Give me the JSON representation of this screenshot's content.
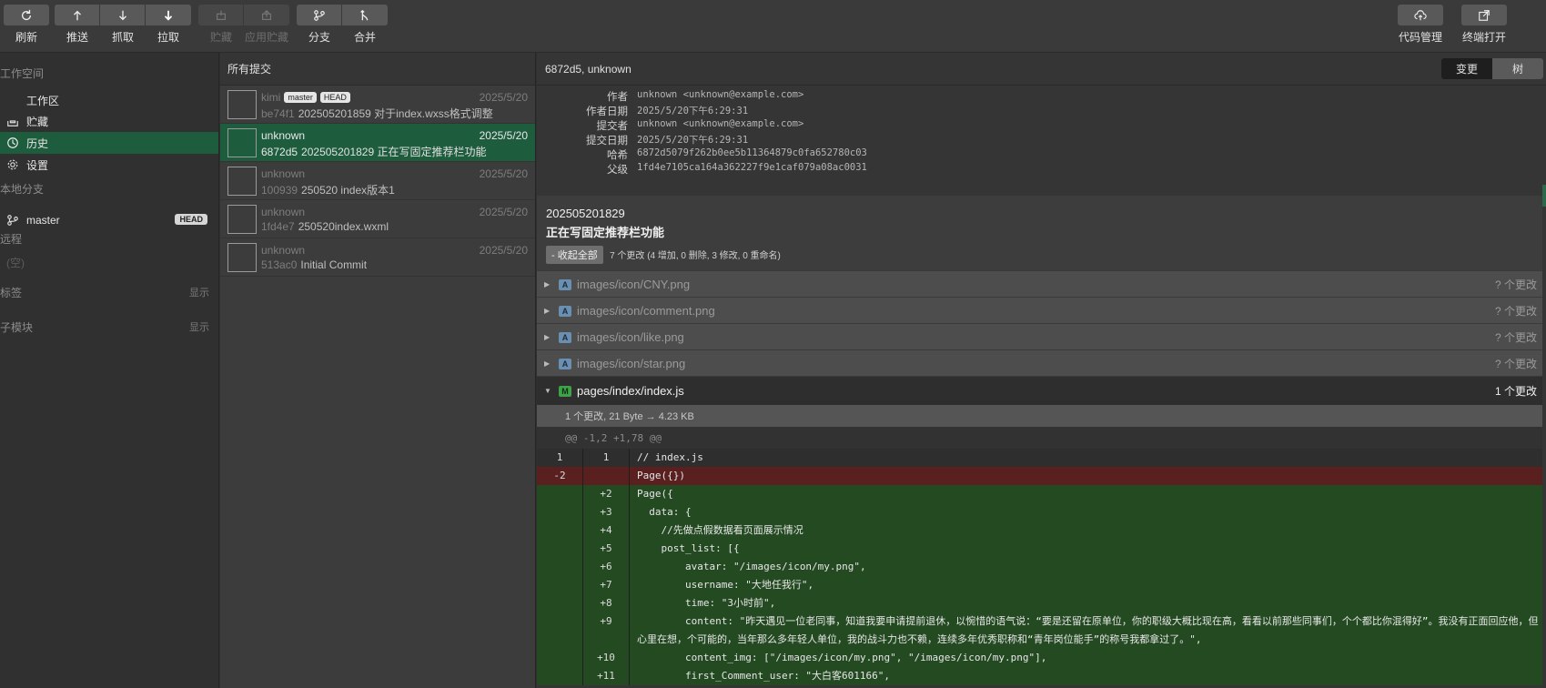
{
  "toolbar": {
    "refresh": "刷新",
    "push": "推送",
    "fetch": "抓取",
    "pull": "拉取",
    "stash": "贮藏",
    "apply_stash": "应用贮藏",
    "branch": "分支",
    "merge": "合并",
    "code_mgmt": "代码管理",
    "terminal": "终端打开"
  },
  "sidebar": {
    "workspace_title": "工作空间",
    "workspace_items": [
      {
        "label": "工作区"
      },
      {
        "label": "贮藏"
      },
      {
        "label": "历史"
      },
      {
        "label": "设置"
      }
    ],
    "local_branches_title": "本地分支",
    "branch": {
      "label": "master",
      "badge": "HEAD"
    },
    "remote_title": "远程",
    "remote_empty": "(空)",
    "tags_title": "标签",
    "tags_show": "显示",
    "submodules_title": "子模块",
    "submodules_show": "显示"
  },
  "commit_list": {
    "header": "所有提交",
    "commits": [
      {
        "author": "kimi",
        "badges": [
          "master",
          "HEAD"
        ],
        "date": "2025/5/20",
        "hash": "be74f1",
        "message": "202505201859 对于index.wxss格式调整"
      },
      {
        "author": "unknown",
        "badges": [],
        "date": "2025/5/20",
        "hash": "6872d5",
        "message": "202505201829 正在写固定推荐栏功能"
      },
      {
        "author": "unknown",
        "badges": [],
        "date": "2025/5/20",
        "hash": "100939",
        "message": "250520 index版本1"
      },
      {
        "author": "unknown",
        "badges": [],
        "date": "2025/5/20",
        "hash": "1fd4e7",
        "message": "250520index.wxml"
      },
      {
        "author": "unknown",
        "badges": [],
        "date": "2025/5/20",
        "hash": "513ac0",
        "message": "Initial Commit"
      }
    ]
  },
  "detail": {
    "header": "6872d5, unknown",
    "seg_changes": "变更",
    "seg_tree": "树",
    "meta": [
      {
        "k": "作者",
        "v": "unknown <unknown@example.com>"
      },
      {
        "k": "作者日期",
        "v": "2025/5/20下午6:29:31"
      },
      {
        "k": "提交者",
        "v": "unknown <unknown@example.com>"
      },
      {
        "k": "提交日期",
        "v": "2025/5/20下午6:29:31"
      },
      {
        "k": "哈希",
        "v": "6872d5079f262b0ee5b11364879c0fa652780c03"
      },
      {
        "k": "父级",
        "v": "1fd4e7105ca164a362227f9e1caf079a08ac0031"
      }
    ],
    "message_line1": "202505201829",
    "message_line2": "正在写固定推荐栏功能",
    "collapse_all": "- 收起全部",
    "change_summary": "7 个更改 (4 增加, 0 删除, 3 修改, 0 重命名)",
    "files": [
      {
        "tag": "A",
        "name": "images/icon/CNY.png",
        "count": "? 个更改",
        "open": false
      },
      {
        "tag": "A",
        "name": "images/icon/comment.png",
        "count": "? 个更改",
        "open": false
      },
      {
        "tag": "A",
        "name": "images/icon/like.png",
        "count": "? 个更改",
        "open": false
      },
      {
        "tag": "A",
        "name": "images/icon/star.png",
        "count": "? 个更改",
        "open": false
      },
      {
        "tag": "M",
        "name": "pages/index/index.js",
        "count": "1 个更改",
        "open": true
      }
    ],
    "diff_info": "1 个更改, 21 Byte → 4.23 KB",
    "hunk": "@@ -1,2 +1,78 @@",
    "lines": [
      {
        "type": "ctx",
        "old": "1",
        "new": "1",
        "code": "// index.js"
      },
      {
        "type": "del",
        "old": "-2",
        "new": "",
        "code": "Page({})"
      },
      {
        "type": "add",
        "old": "",
        "new": "+2",
        "code": "Page({"
      },
      {
        "type": "add",
        "old": "",
        "new": "+3",
        "code": "  data: {"
      },
      {
        "type": "add",
        "old": "",
        "new": "+4",
        "code": "    //先做点假数据看页面展示情况"
      },
      {
        "type": "add",
        "old": "",
        "new": "+5",
        "code": "    post_list: [{"
      },
      {
        "type": "add",
        "old": "",
        "new": "+6",
        "code": "        avatar: \"/images/icon/my.png\","
      },
      {
        "type": "add",
        "old": "",
        "new": "+7",
        "code": "        username: \"大地任我行\","
      },
      {
        "type": "add",
        "old": "",
        "new": "+8",
        "code": "        time: \"3小时前\","
      },
      {
        "type": "add",
        "old": "",
        "new": "+9",
        "code": "        content: \"昨天遇见一位老同事，知道我要申请提前退休，以惋惜的语气说：“要是还留在原单位，你的职级大概比现在高，看看以前那些同事们，个个都比你混得好”。我没有正面回应他，但心里在想，个可能的，当年那么多年轻人单位，我的战斗力也不赖，连续多年优秀职称和“青年岗位能手”的称号我都拿过了。\","
      },
      {
        "type": "add",
        "old": "",
        "new": "+10",
        "code": "        content_img: [\"/images/icon/my.png\", \"/images/icon/my.png\"],"
      },
      {
        "type": "add",
        "old": "",
        "new": "+11",
        "code": "        first_Comment_user: \"大白客601166\","
      }
    ]
  }
}
